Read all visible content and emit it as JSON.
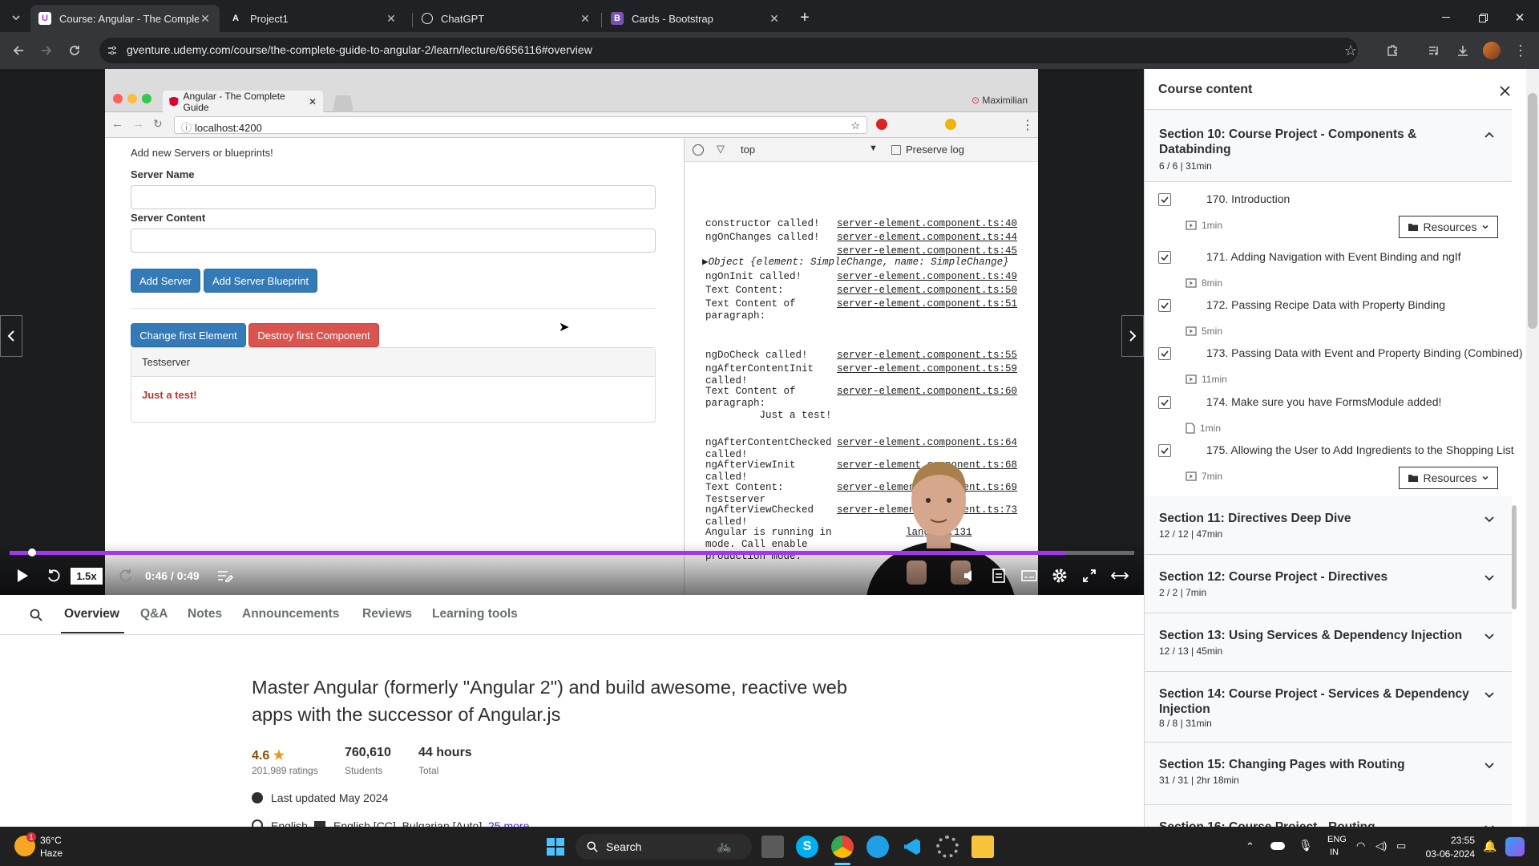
{
  "browser": {
    "tabs": [
      {
        "label": "Course: Angular - The Complete",
        "active": true,
        "favicon": "udemy-icon"
      },
      {
        "label": "Project1",
        "active": false,
        "favicon": "angular-icon"
      },
      {
        "label": "ChatGPT",
        "active": false,
        "favicon": "chatgpt-icon"
      },
      {
        "label": "Cards - Bootstrap",
        "active": false,
        "favicon": "bootstrap-icon"
      }
    ],
    "url": "gventure.udemy.com/course/the-complete-guide-to-angular-2/learn/lecture/6656116#overview"
  },
  "video": {
    "inner_browser": {
      "tab_title": "Angular - The Complete Guide",
      "url": "localhost:4200",
      "profile": "Maximilian"
    },
    "demo_app": {
      "heading": "Add new Servers or blueprints!",
      "server_name_label": "Server Name",
      "server_content_label": "Server Content",
      "add_server": "Add Server",
      "add_blueprint": "Add Server Blueprint",
      "change_first": "Change first Element",
      "destroy_first": "Destroy first Component",
      "panel_title": "Testserver",
      "panel_body": "Just a test!"
    },
    "devtools": {
      "context": "top",
      "preserve_log": "Preserve log",
      "logs": [
        {
          "msg": "constructor called!",
          "src": "server-element.component.ts:40"
        },
        {
          "msg": "ngOnChanges called!",
          "src": "server-element.component.ts:44"
        },
        {
          "msg": "",
          "src": "server-element.component.ts:45"
        },
        {
          "msg": "▶Object {element: SimpleChange, name: SimpleChange}",
          "src": ""
        },
        {
          "msg": "ngOnInit called!",
          "src": "server-element.component.ts:49"
        },
        {
          "msg": "Text Content:",
          "src": "server-element.component.ts:50"
        },
        {
          "msg": "Text Content of\nparagraph:",
          "src": "server-element.component.ts:51"
        },
        {
          "msg": "ngDoCheck called!",
          "src": "server-element.component.ts:55"
        },
        {
          "msg": "ngAfterContentInit\ncalled!",
          "src": "server-element.component.ts:59"
        },
        {
          "msg": "Text Content of\nparagraph:\n         Just a test!",
          "src": "server-element.component.ts:60"
        },
        {
          "msg": "ngAfterContentChecked\ncalled!",
          "src": "server-element.component.ts:64"
        },
        {
          "msg": "ngAfterViewInit\ncalled!",
          "src": "server-element.component.ts:68"
        },
        {
          "msg": "Text Content:\nTestserver",
          "src": "server-element.component.ts:69"
        },
        {
          "msg": "ngAfterViewChecked\ncalled!",
          "src": "server-element.component.ts:73"
        },
        {
          "msg": "Angular is running in\nmode. Call enable\nproduction mode.",
          "src": "lang.js:131"
        }
      ]
    },
    "controls": {
      "speed": "1.5x",
      "time": "0:46 / 0:49",
      "progress": 0.9388
    }
  },
  "subnav": {
    "items": [
      "Overview",
      "Q&A",
      "Notes",
      "Announcements",
      "Reviews",
      "Learning tools"
    ],
    "active": "Overview"
  },
  "overview": {
    "headline": "Master Angular (formerly \"Angular 2\") and build awesome, reactive web apps with the successor of Angular.js",
    "rating": "4.6",
    "rating_count": "201,989 ratings",
    "students": "760,610",
    "students_label": "Students",
    "hours": "44 hours",
    "hours_label": "Total",
    "updated": "Last updated May 2024",
    "language": "English",
    "captions": "English [CC], Bulgarian [Auto],",
    "more": "25 more"
  },
  "sidebar": {
    "title": "Course content",
    "open_section": {
      "title": "Section 10: Course Project - Components & Databinding",
      "meta": "6 / 6 | 31min",
      "lectures": [
        {
          "title": "170. Introduction",
          "duration": "1min",
          "kind": "video",
          "resources": "Resources"
        },
        {
          "title": "171. Adding Navigation with Event Binding and ngIf",
          "duration": "8min",
          "kind": "video",
          "resources": ""
        },
        {
          "title": "172. Passing Recipe Data with Property Binding",
          "duration": "5min",
          "kind": "video",
          "resources": ""
        },
        {
          "title": "173. Passing Data with Event and Property Binding (Combined)",
          "duration": "11min",
          "kind": "video",
          "resources": ""
        },
        {
          "title": "174. Make sure you have FormsModule added!",
          "duration": "1min",
          "kind": "article",
          "resources": ""
        },
        {
          "title": "175. Allowing the User to Add Ingredients to the Shopping List",
          "duration": "7min",
          "kind": "video",
          "resources": "Resources"
        }
      ]
    },
    "sections": [
      {
        "title": "Section 11: Directives Deep Dive",
        "meta": "12 / 12 | 47min"
      },
      {
        "title": "Section 12: Course Project - Directives",
        "meta": "2 / 2 | 7min"
      },
      {
        "title": "Section 13: Using Services & Dependency Injection",
        "meta": "12 / 13 | 45min"
      },
      {
        "title": "Section 14: Course Project - Services & Dependency Injection",
        "meta": "8 / 8 | 31min"
      },
      {
        "title": "Section 15: Changing Pages with Routing",
        "meta": "31 / 31 | 2hr 18min"
      },
      {
        "title": "Section 16: Course Project - Routing",
        "meta": ""
      }
    ]
  },
  "taskbar": {
    "weather_temp": "36°C",
    "weather_desc": "Haze",
    "search": "Search",
    "lang_top": "ENG",
    "lang_bottom": "IN",
    "time": "23:55",
    "date": "03-06-2024"
  },
  "colors": {
    "accent": "#a435f0",
    "bootstrap_primary": "#337ab7",
    "bootstrap_danger": "#d9534f"
  }
}
